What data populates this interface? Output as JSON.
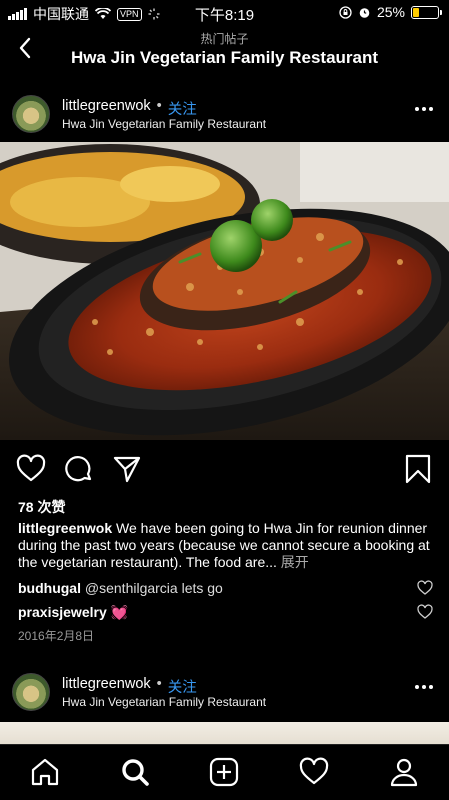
{
  "status": {
    "carrier": "中国联通",
    "vpn": "VPN",
    "time": "下午8:19",
    "battery": "25%",
    "battery_level": 0.25,
    "battery_color": "#ffcc00"
  },
  "header": {
    "subtitle": "热门帖子",
    "title": "Hwa Jin Vegetarian Family Restaurant"
  },
  "post1": {
    "username": "littlegreenwok",
    "separator": "•",
    "follow": "关注",
    "location": "Hwa Jin Vegetarian Family Restaurant",
    "likes": "78 次赞",
    "caption_user": "littlegreenwok",
    "caption_text": "We have been going to Hwa Jin for reunion dinner during the past two years (because we cannot secure a booking at the vegetarian restaurant). The food are...",
    "caption_more": "展开",
    "comments": [
      {
        "user": "budhugal",
        "text": "@senthilgarcia lets go"
      },
      {
        "user": "praxisjewelry",
        "text": "💓"
      }
    ],
    "date": "2016年2月8日"
  },
  "post2": {
    "username": "littlegreenwok",
    "separator": "•",
    "follow": "关注",
    "location": "Hwa Jin Vegetarian Family Restaurant"
  },
  "colors": {
    "accent": "#3897f0",
    "comment_heart": "#e8448a"
  },
  "icons": {
    "back": "chevron-left-icon",
    "like": "heart-icon",
    "comment": "comment-icon",
    "share": "send-icon",
    "save": "bookmark-icon",
    "more": "more-horizontal-icon",
    "home": "home-icon",
    "search": "search-icon",
    "add": "add-post-icon",
    "activity": "heart-icon",
    "profile": "profile-icon"
  }
}
